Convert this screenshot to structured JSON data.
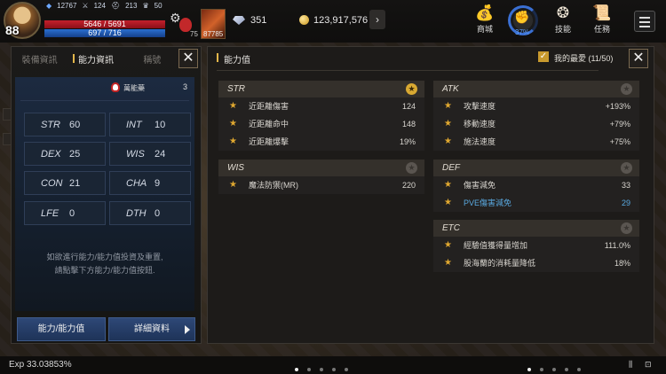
{
  "hud": {
    "level": "88",
    "power": "12767",
    "stat_a": "124",
    "stat_b": "213",
    "stat_c": "50",
    "hp": "5646 / 5691",
    "mp": "697 / 716",
    "potion_count": "75",
    "skill_count": "87785",
    "diamonds": "351",
    "gold": "123,917,576",
    "menu": [
      {
        "label": "商城",
        "icon": "shop-icon"
      },
      {
        "label": "37%",
        "icon": "fist-icon"
      },
      {
        "label": "技能",
        "icon": "skill-icon"
      },
      {
        "label": "任務",
        "icon": "quest-icon"
      }
    ]
  },
  "left_panel": {
    "tabs": [
      "裝備資訊",
      "能力資訊",
      "稱號"
    ],
    "active_tab": 1,
    "ap_label": "萬能藥",
    "ap_value": "3",
    "stats": [
      {
        "key": "STR",
        "val": "60"
      },
      {
        "key": "INT",
        "val": "10"
      },
      {
        "key": "DEX",
        "val": "25"
      },
      {
        "key": "WIS",
        "val": "24"
      },
      {
        "key": "CON",
        "val": "21"
      },
      {
        "key": "CHA",
        "val": "9"
      },
      {
        "key": "LFE",
        "val": "0"
      },
      {
        "key": "DTH",
        "val": "0"
      }
    ],
    "note_line1": "如欲進行能力/能力值投資及重置,",
    "note_line2": "請點擊下方能力/能力值按鈕.",
    "btn_ability": "能力/能力值",
    "btn_detail": "詳細資料"
  },
  "right_panel": {
    "title": "能力值",
    "favorites": "我的最愛 (11/50)",
    "categories": {
      "str": {
        "name": "STR",
        "starred": true,
        "rows": [
          {
            "label": "近距離傷害",
            "val": "124"
          },
          {
            "label": "近距離命中",
            "val": "148"
          },
          {
            "label": "近距離爆擊",
            "val": "19%"
          }
        ]
      },
      "wis": {
        "name": "WIS",
        "starred": false,
        "rows": [
          {
            "label": "魔法防禦(MR)",
            "val": "220"
          }
        ]
      },
      "atk": {
        "name": "ATK",
        "starred": false,
        "rows": [
          {
            "label": "攻擊速度",
            "val": "+193%"
          },
          {
            "label": "移動速度",
            "val": "+79%"
          },
          {
            "label": "施法速度",
            "val": "+75%"
          }
        ]
      },
      "def": {
        "name": "DEF",
        "starred": false,
        "rows": [
          {
            "label": "傷害減免",
            "val": "33"
          },
          {
            "label": "PVE傷害減免",
            "val": "29"
          }
        ]
      },
      "etc": {
        "name": "ETC",
        "starred": false,
        "rows": [
          {
            "label": "經驗值獲得量增加",
            "val": "111.0%"
          },
          {
            "label": "股海蘭的消耗量降低",
            "val": "18%"
          }
        ]
      }
    }
  },
  "bottom": {
    "exp": "Exp 33.03853%"
  },
  "colors": {
    "accent_gold": "#e3b64a",
    "hp": "#c4202c",
    "mp": "#2a6fd0",
    "highlight_blue": "#5aa9e0",
    "button_blue": "#2e4877"
  }
}
